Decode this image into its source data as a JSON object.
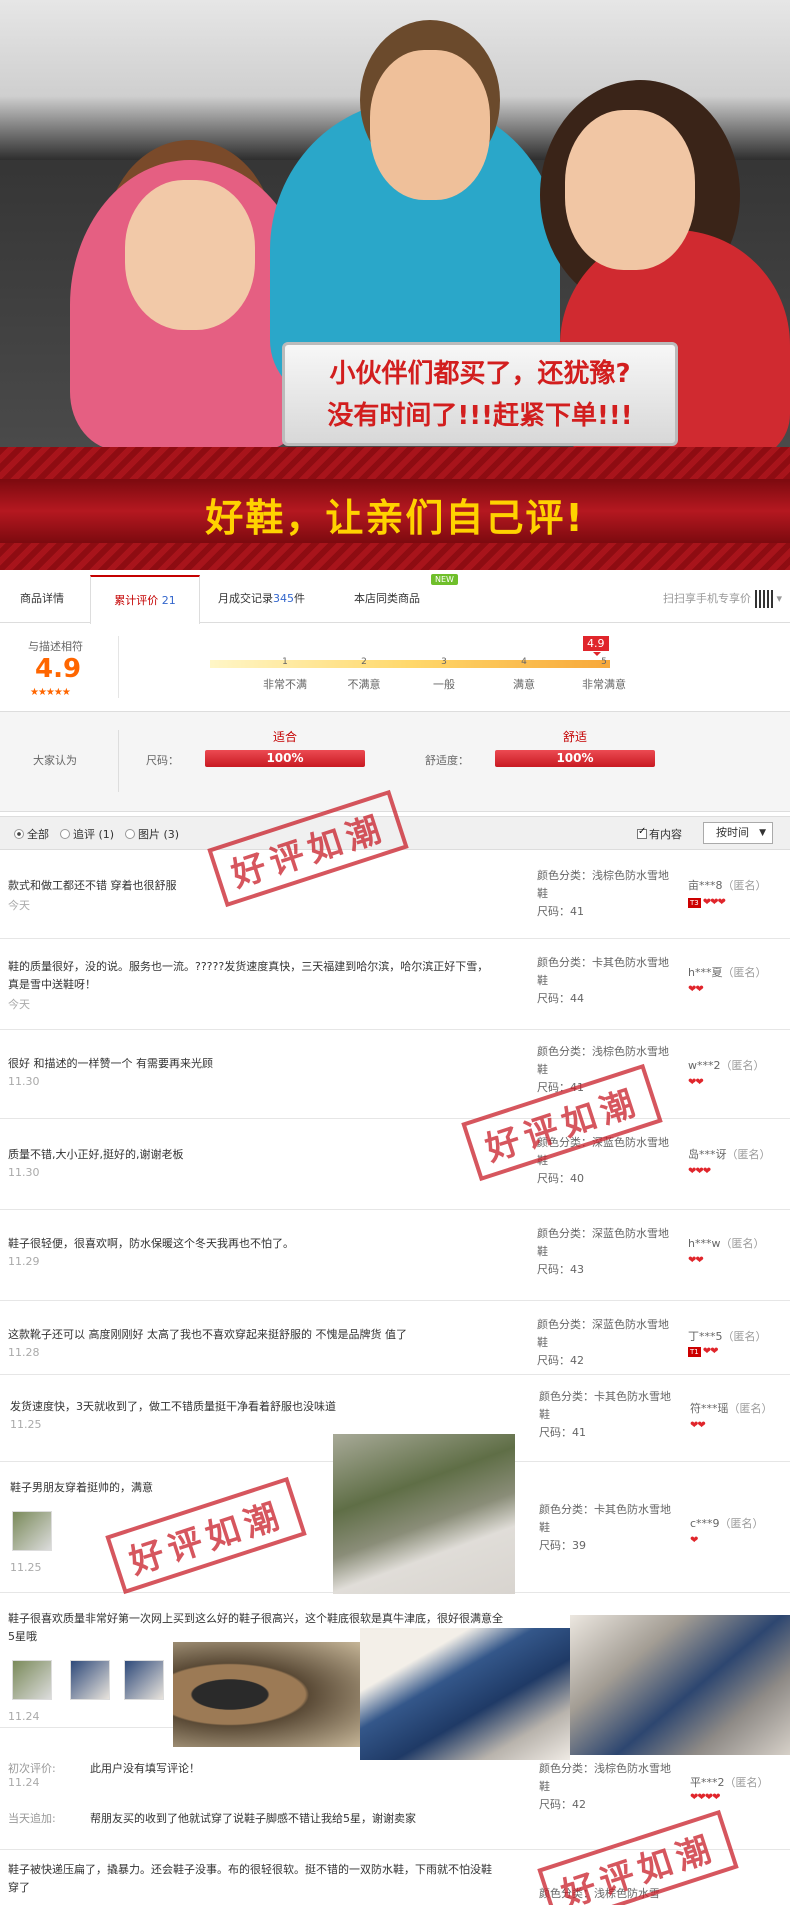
{
  "hero": {
    "line1": "小伙伴们都买了，还犹豫?",
    "line2": "没有时间了!!!赶紧下单!!!"
  },
  "band": {
    "slogan": "好鞋，让亲们自己评!"
  },
  "tabs": [
    {
      "label": "商品详情"
    },
    {
      "label": "累计评价",
      "count": "21"
    },
    {
      "label": "月成交记录",
      "count": "345",
      "suffix": "件"
    },
    {
      "label": "本店同类商品"
    }
  ],
  "new_badge": "NEW",
  "scan_label": "扫扫享手机专享价",
  "rating": {
    "label": "与描述相符",
    "score": "4.9",
    "stars": "★★★★★",
    "flag": "4.9",
    "ticks": [
      "1",
      "2",
      "3",
      "4",
      "5"
    ],
    "tick_labels": [
      "非常不满",
      "不满意",
      "一般",
      "满意",
      "非常满意"
    ]
  },
  "opinion": {
    "label": "大家认为",
    "attrs": [
      {
        "name": "尺码：",
        "title": "适合",
        "value": "100%"
      },
      {
        "name": "舒适度：",
        "title": "舒适",
        "value": "100%"
      }
    ]
  },
  "filters": {
    "all": "全部",
    "follow": "追评 (1)",
    "pics": "图片 (3)",
    "has_content": "有内容",
    "sort": "按时间"
  },
  "stamp_text": "好评如潮",
  "reviews": [
    {
      "content": "款式和做工都还不错 穿着也很舒服",
      "date": "今天",
      "color": "颜色分类：浅棕色防水雪地鞋",
      "size": "尺码：41",
      "user": "亩***8",
      "anon": "（匿名）",
      "level": "T3",
      "hearts": "❤❤❤"
    },
    {
      "content": "鞋的质量很好，没的说。服务也一流。?????发货速度真快，三天福建到哈尔滨，哈尔滨正好下雪，真是雪中送鞋呀！",
      "date": "今天",
      "color": "颜色分类：卡其色防水雪地鞋",
      "size": "尺码：44",
      "user": "h***夏",
      "anon": "（匿名）",
      "hearts": "❤❤"
    },
    {
      "content": "很好 和描述的一样赞一个 有需要再来光顾",
      "date": "11.30",
      "color": "颜色分类：浅棕色防水雪地鞋",
      "size": "尺码：41",
      "user": "w***2",
      "anon": "（匿名）",
      "hearts": "❤❤"
    },
    {
      "content": "质量不错,大小正好,挺好的,谢谢老板",
      "date": "11.30",
      "color": "颜色分类：深蓝色防水雪地鞋",
      "size": "尺码：40",
      "user": "岛***讶",
      "anon": "（匿名）",
      "hearts": "❤❤❤"
    },
    {
      "content": "鞋子很轻便，很喜欢啊，防水保暖这个冬天我再也不怕了。",
      "date": "11.29",
      "color": "颜色分类：深蓝色防水雪地鞋",
      "size": "尺码：43",
      "user": "h***w",
      "anon": "（匿名）",
      "hearts": "❤❤"
    },
    {
      "content": "这款靴子还可以 高度刚刚好 太高了我也不喜欢穿起来挺舒服的 不愧是品牌货 值了",
      "date": "11.28",
      "color": "颜色分类：深蓝色防水雪地鞋",
      "size": "尺码：42",
      "user": "丁***5",
      "anon": "（匿名）",
      "level": "T1",
      "hearts": "❤❤"
    },
    {
      "content": "发货速度快，3天就收到了，做工不错质量挺干净看着舒服也没味道",
      "date": "11.25",
      "color": "颜色分类：卡其色防水雪地鞋",
      "size": "尺码：41",
      "user": "符***瑶",
      "anon": "（匿名）",
      "hearts": "❤❤"
    },
    {
      "content": "鞋子男朋友穿着挺帅的，满意",
      "date": "11.25",
      "color": "颜色分类：卡其色防水雪地鞋",
      "size": "尺码：39",
      "user": "c***9",
      "anon": "（匿名）",
      "hearts": "❤"
    },
    {
      "content": "鞋子很喜欢质量非常好第一次网上买到这么好的鞋子很高兴，这个鞋底很软是真牛津底，很好很满意全5星哦",
      "date": "11.24"
    },
    {
      "first_label": "初次评价:",
      "content": "此用户没有填写评论！",
      "date": "11.24",
      "follow_label": "当天追加:",
      "follow": "帮朋友买的收到了他就试穿了说鞋子脚感不错让我给5星，谢谢卖家",
      "color": "颜色分类：浅棕色防水雪地鞋",
      "size": "尺码：42",
      "user": "平***2",
      "anon": "（匿名）",
      "hearts": "❤❤❤❤"
    },
    {
      "content": "鞋子被快递压扁了，撬暴力。还会鞋子没事。布的很轻很软。挺不错的一双防水鞋，下雨就不怕没鞋穿了",
      "color": "颜色分类：浅棕色防水雪"
    }
  ]
}
